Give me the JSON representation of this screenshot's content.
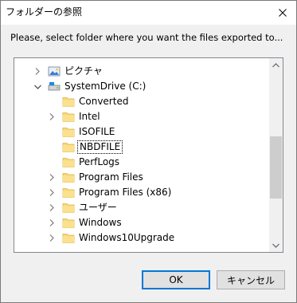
{
  "dialog": {
    "title": "フォルダーの参照",
    "instruction": "Please, select folder where you want the files exported to..."
  },
  "tree": {
    "items": [
      {
        "label": "ピクチャ",
        "level": 0,
        "expander": "collapsed",
        "icon": "pictures-icon",
        "selected": false
      },
      {
        "label": "SystemDrive (C:)",
        "level": 0,
        "expander": "expanded",
        "icon": "drive-icon",
        "selected": false
      },
      {
        "label": "Converted",
        "level": 1,
        "expander": "none",
        "icon": "folder-icon",
        "selected": false
      },
      {
        "label": "Intel",
        "level": 1,
        "expander": "collapsed",
        "icon": "folder-icon",
        "selected": false
      },
      {
        "label": "ISOFILE",
        "level": 1,
        "expander": "none",
        "icon": "folder-icon",
        "selected": false
      },
      {
        "label": "NBDFILE",
        "level": 1,
        "expander": "none",
        "icon": "folder-icon",
        "selected": true
      },
      {
        "label": "PerfLogs",
        "level": 1,
        "expander": "none",
        "icon": "folder-icon",
        "selected": false
      },
      {
        "label": "Program Files",
        "level": 1,
        "expander": "collapsed",
        "icon": "folder-icon",
        "selected": false
      },
      {
        "label": "Program Files (x86)",
        "level": 1,
        "expander": "collapsed",
        "icon": "folder-icon",
        "selected": false
      },
      {
        "label": "ユーザー",
        "level": 1,
        "expander": "collapsed",
        "icon": "folder-icon",
        "selected": false
      },
      {
        "label": "Windows",
        "level": 1,
        "expander": "collapsed",
        "icon": "folder-icon",
        "selected": false
      },
      {
        "label": "Windows10Upgrade",
        "level": 1,
        "expander": "collapsed",
        "icon": "folder-icon",
        "selected": false
      }
    ]
  },
  "scrollbar": {
    "position": 0.62
  },
  "buttons": {
    "ok_label": "OK",
    "cancel_label": "キャンセル"
  },
  "colors": {
    "folder": "#f8d775",
    "selection_border": "#000000",
    "default_button_border": "#0078d7"
  }
}
